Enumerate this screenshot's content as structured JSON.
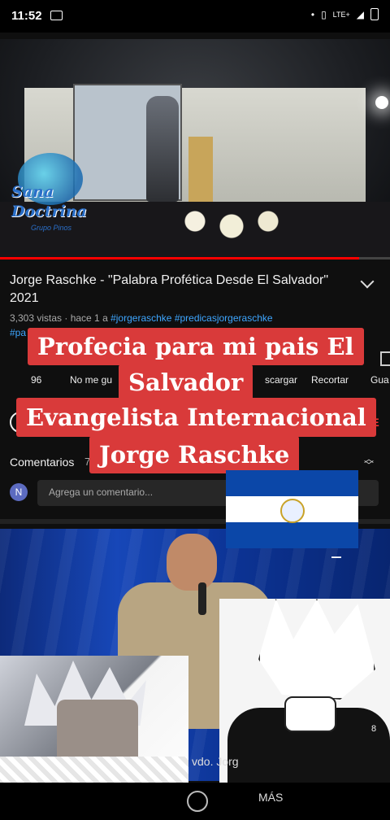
{
  "status_bar": {
    "time": "11:52",
    "dot": "•",
    "network": "LTE+"
  },
  "video": {
    "watermark_line1": "Sana",
    "watermark_line2": "Doctrina",
    "watermark_sub": "Grupo Pinos",
    "progress": 0.92
  },
  "details": {
    "title": "Jorge Raschke - \"Palabra Profética Desde El Salvador\" 2021",
    "views": "3,303 vistas · hace 1 a",
    "tag1": "#jorgeraschke",
    "tag2": "#predicasjorgeraschke",
    "tag3": "#pa"
  },
  "actions": {
    "likes": "96",
    "dislike": "No me gu",
    "download": "scargar",
    "clip": "Recortar",
    "save": "Gua"
  },
  "channel": {
    "subscribe": "SE"
  },
  "comments": {
    "label": "Comentarios",
    "count": "7",
    "avatar_letter": "N",
    "placeholder": "Agrega un comentario..."
  },
  "overlay": {
    "line1": "Profecia para mi pais El",
    "line2": "Salvador",
    "line3": "Evangelista Internacional",
    "line4": "Jorge Raschke"
  },
  "video2": {
    "caption": "vdo. Jorg",
    "timer": "8"
  },
  "navbar": {
    "more": "MÁS"
  },
  "colors": {
    "accent_red": "#d93a3a",
    "link_blue": "#3ea6ff",
    "flag_blue": "#0b47a8"
  }
}
